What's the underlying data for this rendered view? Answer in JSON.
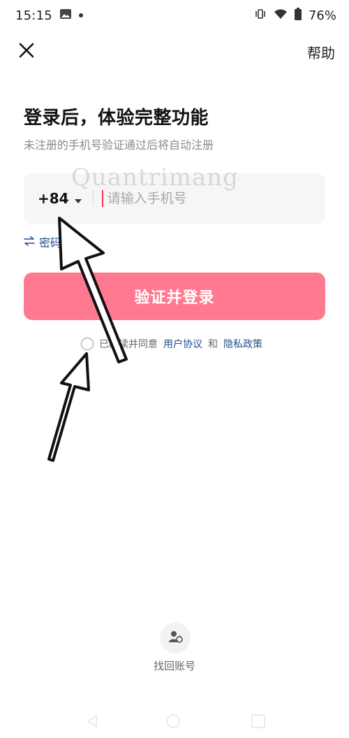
{
  "status_bar": {
    "time": "15:15",
    "battery": "76%",
    "icons": [
      "gallery-icon",
      "vibrate-icon",
      "wifi-icon",
      "battery-icon"
    ]
  },
  "topbar": {
    "close_icon": "close-icon",
    "help_label": "帮助"
  },
  "content": {
    "title": "登录后，体验完整功能",
    "subtitle": "未注册的手机号验证通过后将自动注册",
    "country_code": "+84",
    "phone_placeholder": "请输入手机号",
    "phone_value": "",
    "password_login": "密码登录",
    "submit_label": "验证并登录",
    "agreement": {
      "prefix": "已阅读并同意",
      "user_agreement": "用户协议",
      "and": "和",
      "privacy_policy": "隐私政策"
    }
  },
  "watermark": "Quantrimang",
  "footer": {
    "recover_label": "找回账号"
  },
  "colors": {
    "accent": "#ff7a91",
    "link": "#1f4f8b",
    "caret": "#ff2c55"
  }
}
